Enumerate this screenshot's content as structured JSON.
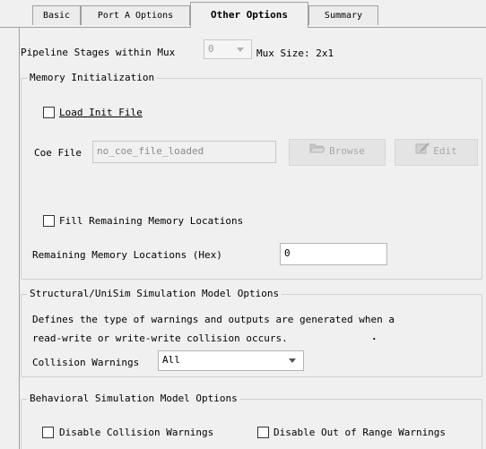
{
  "tabs": [
    {
      "label": "Basic"
    },
    {
      "label": "Port A Options"
    },
    {
      "label": "Other Options"
    },
    {
      "label": "Summary"
    }
  ],
  "pipeline": {
    "label": "Pipeline Stages within Mux",
    "value": "0",
    "mux_size_label": "Mux Size: 2x1"
  },
  "memory_init": {
    "legend": "Memory Initialization",
    "load_init_label": "Load Init File",
    "load_init_checked": false,
    "coe_label": "Coe File",
    "coe_value": "no_coe_file_loaded",
    "browse_label": "Browse",
    "edit_label": "Edit",
    "fill_label": "Fill Remaining Memory Locations",
    "fill_checked": false,
    "remaining_label": "Remaining Memory Locations (Hex)",
    "remaining_value": "0"
  },
  "structural": {
    "legend": "Structural/UniSim Simulation Model Options",
    "desc_line1": "Defines the type of warnings and outputs are generated when a",
    "desc_line2": "read-write or write-write collision occurs.",
    "collision_label": "Collision Warnings",
    "collision_value": "All"
  },
  "behavioral": {
    "legend": "Behavioral Simulation Model Options",
    "disable_collision_label": "Disable Collision Warnings",
    "disable_collision_checked": false,
    "disable_range_label": "Disable Out of Range Warnings",
    "disable_range_checked": false
  },
  "colors": {
    "background": "#f0f0f0",
    "border": "#a0a0a0",
    "disabled_text": "#a8a8a8"
  }
}
